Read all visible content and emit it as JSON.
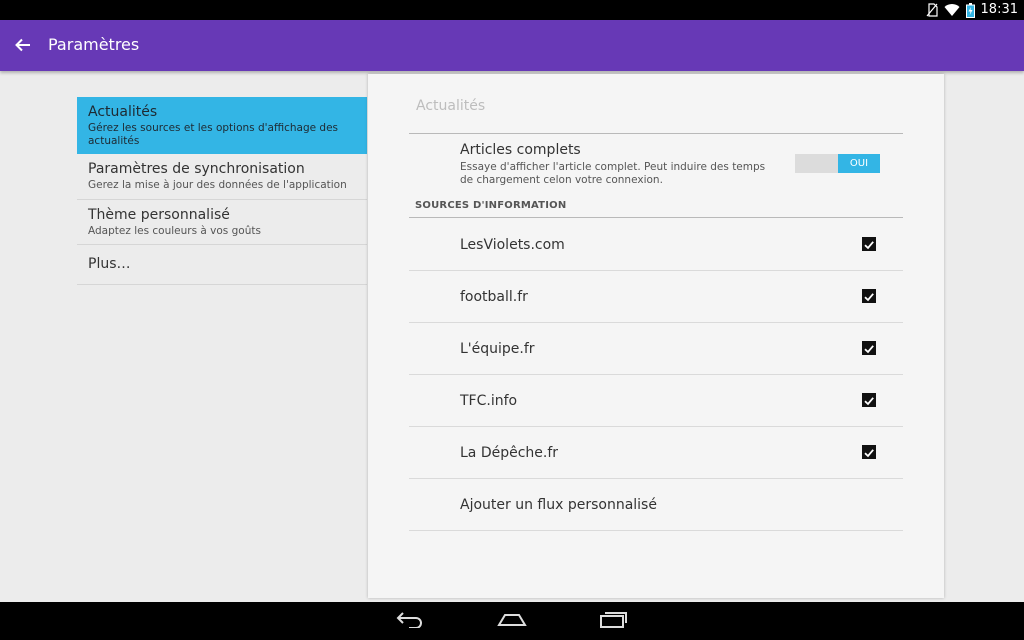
{
  "status_bar": {
    "time": "18:31",
    "icons": [
      "no-sim-icon",
      "wifi-icon",
      "battery-charging-icon"
    ]
  },
  "app_bar": {
    "title": "Paramètres",
    "back_icon": "arrow-back-icon",
    "color": "#6739b6"
  },
  "sidebar": {
    "items": [
      {
        "title": "Actualités",
        "subtitle": "Gérez les sources et les options d'affichage des actualités",
        "active": true
      },
      {
        "title": "Paramètres de synchronisation",
        "subtitle": "Gerez la mise à jour des données de l'application",
        "active": false
      },
      {
        "title": "Thème personnalisé",
        "subtitle": "Adaptez les couleurs à vos goûts",
        "active": false
      },
      {
        "title": "Plus…",
        "subtitle": "",
        "active": false
      }
    ],
    "active_color": "#33b5e5"
  },
  "panel": {
    "section_title": "Actualités",
    "full_articles": {
      "title": "Articles complets",
      "description": "Essaye d'afficher l'article complet. Peut induire des temps de chargement celon votre connexion.",
      "toggle_label": "OUI",
      "enabled": true
    },
    "sources_header": "SOURCES D'INFORMATION",
    "sources": [
      {
        "label": "LesViolets.com",
        "checked": true
      },
      {
        "label": "football.fr",
        "checked": true
      },
      {
        "label": "L'équipe.fr",
        "checked": true
      },
      {
        "label": "TFC.info",
        "checked": true
      },
      {
        "label": "La Dépêche.fr",
        "checked": true
      }
    ],
    "add_feed_label": "Ajouter un flux personnalisé"
  },
  "nav_bar": {
    "buttons": [
      "back-nav-icon",
      "home-icon",
      "recents-icon"
    ]
  }
}
